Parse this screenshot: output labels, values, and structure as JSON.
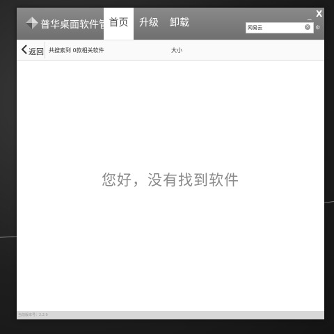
{
  "window": {
    "app_title": "普华桌面软件管家",
    "logo_icon": "diamond-logo-icon"
  },
  "tabs": [
    {
      "label": "首页",
      "active": true
    },
    {
      "label": "升级",
      "active": false
    },
    {
      "label": "卸载",
      "active": false
    }
  ],
  "window_controls": {
    "minimize": "_",
    "close": "X"
  },
  "search": {
    "value": "网易云",
    "clear_icon": "clear-icon",
    "settings_icon": "gear-icon"
  },
  "toolbar": {
    "back_label": "返回",
    "result_text": "共搜索到 0款相关软件",
    "size_header": "大小"
  },
  "main": {
    "empty_message": "您好，没有找到软件"
  },
  "status": {
    "version_text": "当前版本号：2.2.9"
  },
  "colors": {
    "titlebar": "#7d7d7d",
    "accent_text": "#8a8a8a",
    "desktop": "#1e1e1e"
  }
}
